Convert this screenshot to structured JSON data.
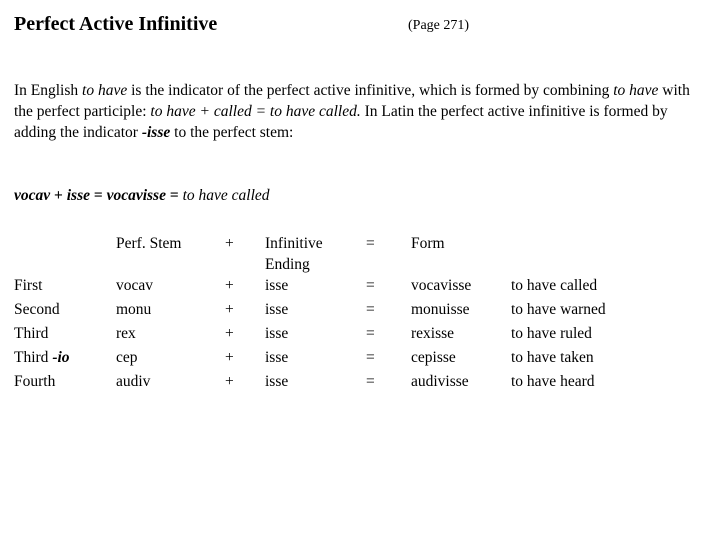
{
  "header": {
    "title": "Perfect Active Infinitive",
    "page_ref": "(Page 271)"
  },
  "intro": {
    "seg1": "In English ",
    "seg2_italic": "to have",
    "seg3": " is the indicator of the perfect active infinitive, which is formed by combining ",
    "seg4_italic": "to have",
    "seg5": " with the perfect participle: ",
    "seg6_italic": "to have + called = to have called.",
    "seg7": " In Latin the perfect active infinitive is formed by adding the indicator ",
    "seg8_bold_italic": "-isse",
    "seg9": " to the perfect stem:"
  },
  "example": {
    "stem": "vocav",
    "plus": "+",
    "ending": "isse",
    "equals": "=",
    "form": "vocavisse",
    "equals2": "=",
    "translation": "to have called"
  },
  "table": {
    "headers": {
      "conjugation": "",
      "stem": "Perf. Stem",
      "plus": "+",
      "ending_line1": "Infinitive",
      "ending_line2": "Ending",
      "equals": "=",
      "form": "Form",
      "translation": ""
    },
    "rows": [
      {
        "conj_roman": "First",
        "conj_suffix": "",
        "stem": "vocav",
        "plus": "+",
        "ending": "isse",
        "equals": "=",
        "form": "vocavisse",
        "translation": "to have called"
      },
      {
        "conj_roman": "Second",
        "conj_suffix": "",
        "stem": "monu",
        "plus": "+",
        "ending": "isse",
        "equals": "=",
        "form": "monuisse",
        "translation": "to have warned"
      },
      {
        "conj_roman": "Third",
        "conj_suffix": "",
        "stem": "rex",
        "plus": "+",
        "ending": "isse",
        "equals": "=",
        "form": "rexisse",
        "translation": "to have ruled"
      },
      {
        "conj_roman": "Third ",
        "conj_suffix": "-io",
        "stem": "cep",
        "plus": "+",
        "ending": "isse",
        "equals": "=",
        "form": "cepisse",
        "translation": "to have taken"
      },
      {
        "conj_roman": "Fourth",
        "conj_suffix": "",
        "stem": "audiv",
        "plus": "+",
        "ending": "isse",
        "equals": "=",
        "form": "audivisse",
        "translation": "to have heard"
      }
    ]
  },
  "colors": {
    "text": "#000000",
    "background": "#ffffff"
  }
}
